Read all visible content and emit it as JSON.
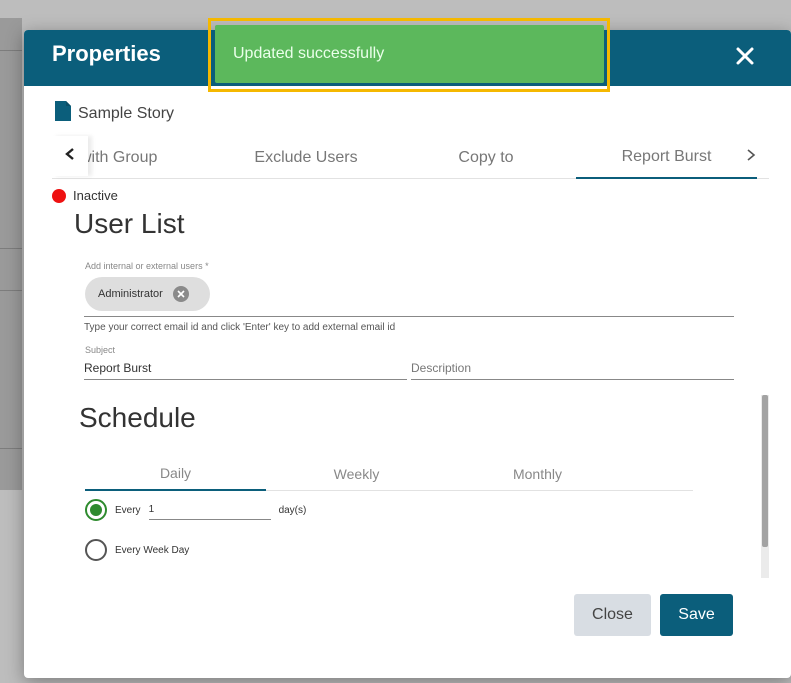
{
  "dialog": {
    "title": "Properties",
    "close_icon": "close-icon"
  },
  "toast": {
    "message": "Updated successfully",
    "color": "#5cb85c",
    "highlight_color": "#f5b800"
  },
  "story": {
    "icon": "document-icon",
    "name": "Sample Story"
  },
  "tabs": {
    "items": [
      {
        "label": "with Group"
      },
      {
        "label": "Exclude Users"
      },
      {
        "label": "Copy to"
      },
      {
        "label": "Report Burst",
        "active": true
      }
    ]
  },
  "status": {
    "label": "Inactive",
    "color": "#ee1111"
  },
  "user_list": {
    "heading": "User List",
    "field_label": "Add internal or external users *",
    "chips": [
      {
        "label": "Administrator"
      }
    ],
    "hint": "Type your correct email id and click 'Enter' key to add external email id"
  },
  "subject": {
    "label": "Subject",
    "value": "Report Burst"
  },
  "description": {
    "placeholder": "Description"
  },
  "schedule": {
    "heading": "Schedule",
    "tabs": [
      {
        "label": "Daily",
        "active": true
      },
      {
        "label": "Weekly"
      },
      {
        "label": "Monthly"
      }
    ],
    "options": {
      "every_label": "Every",
      "every_value": "1",
      "every_unit": "day(s)",
      "every_selected": true,
      "week_day_label": "Every Week Day",
      "week_day_selected": false
    }
  },
  "buttons": {
    "close": "Close",
    "save": "Save"
  },
  "theme": {
    "primary": "#0b5e7b"
  }
}
